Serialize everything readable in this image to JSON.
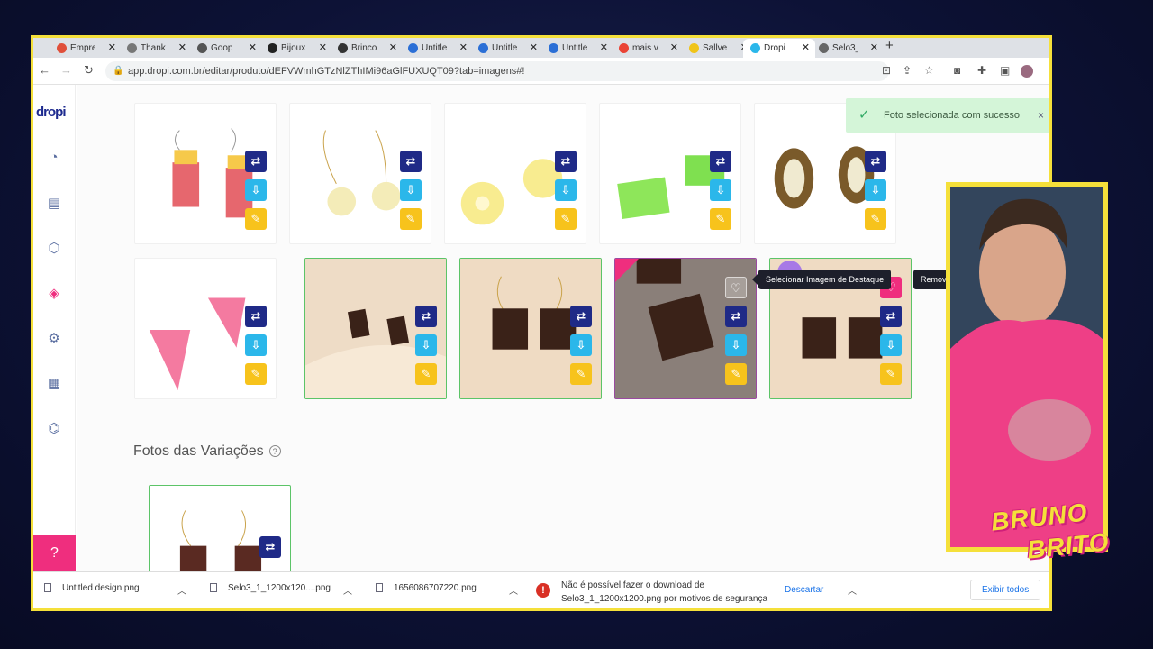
{
  "browser": {
    "tabs": [
      {
        "label": "Empre",
        "color": "#e04f3a"
      },
      {
        "label": "Thank",
        "color": "#777777"
      },
      {
        "label": "Goop",
        "color": "#555555"
      },
      {
        "label": "Bijoux",
        "color": "#222222"
      },
      {
        "label": "Brinco",
        "color": "#333333"
      },
      {
        "label": "Untitle",
        "color": "#2b6fd6"
      },
      {
        "label": "Untitle",
        "color": "#2b6fd6"
      },
      {
        "label": "Untitle",
        "color": "#2b6fd6"
      },
      {
        "label": "mais v",
        "color": "#ea4335"
      },
      {
        "label": "Sallve",
        "color": "#f0c419"
      },
      {
        "label": "Dropi",
        "color": "#2bb7ea"
      },
      {
        "label": "Selo3_",
        "color": "#666666"
      }
    ],
    "url": "app.dropi.com.br/editar/produto/dEFVWmhGTzNlZThIMi96aGlFUXUQT09?tab=imagens#!"
  },
  "sidebar": {
    "logo": "dropi",
    "icons": [
      "chart-pie-icon",
      "store-icon",
      "box-icon",
      "tag-icon",
      "gear-icon",
      "calculator-icon",
      "plug-icon"
    ],
    "help_icon": "?"
  },
  "toast": {
    "message": "Foto selecionada com sucesso",
    "close": "×"
  },
  "gallery": {
    "tooltip_select": "Selecionar Imagem de Destaque",
    "tooltip_remove": "Remover do destaque"
  },
  "variations": {
    "title": "Fotos das Variações",
    "help": "?"
  },
  "downloads": {
    "items": [
      "Untitled design.png",
      "Selo3_1_1200x120....png",
      "1656086707220.png"
    ],
    "error_line1": "Não é possível fazer o download de",
    "error_line2": "Selo3_1_1200x1200.png por motivos de segurança",
    "discard": "Descartar",
    "show_all": "Exibir todos"
  },
  "overlay": {
    "brand_line1": "BRUNO",
    "brand_line2": "BRITO"
  },
  "colors": {
    "accent_pink": "#ef2e7e",
    "navy": "#1f2a87",
    "cyan": "#2bb7ea",
    "yellow": "#f7c31c",
    "frame": "#f5e03a"
  }
}
